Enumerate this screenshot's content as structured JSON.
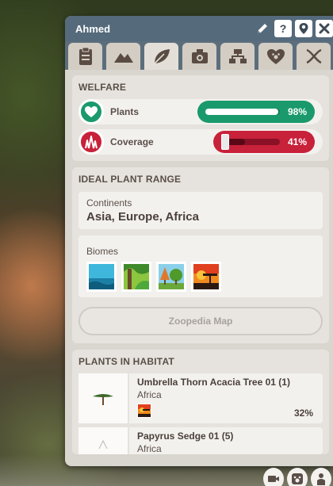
{
  "window": {
    "title": "Ahmed"
  },
  "titlebar_icons": [
    "pencil-icon",
    "help-icon",
    "location-pin-icon",
    "close-icon"
  ],
  "titlebar_glyphs": {
    "help": "?"
  },
  "tabs": [
    {
      "icon": "clipboard-icon",
      "active": false
    },
    {
      "icon": "terrain-icon",
      "active": false
    },
    {
      "icon": "plant-leaf-icon",
      "active": true
    },
    {
      "icon": "enrichment-icon",
      "active": false
    },
    {
      "icon": "hierarchy-icon",
      "active": false
    },
    {
      "icon": "paw-heart-icon",
      "active": false
    },
    {
      "icon": "dna-icon",
      "active": false
    }
  ],
  "welfare": {
    "title": "WELFARE",
    "items": [
      {
        "label": "Plants",
        "percent_text": "98%",
        "value": 0.98,
        "color": "#1a9a6c",
        "icon": "heart-icon"
      },
      {
        "label": "Coverage",
        "percent_text": "41%",
        "value": 0.41,
        "color": "#c8213a",
        "icon": "grass-icon"
      }
    ]
  },
  "ideal_range": {
    "title": "IDEAL PLANT RANGE",
    "continents_label": "Continents",
    "continents_value": "Asia, Europe, Africa",
    "biomes_label": "Biomes",
    "biomes": [
      "aquatic-biome-icon",
      "tropical-biome-icon",
      "temperate-biome-icon",
      "savanna-biome-icon"
    ],
    "map_button": "Zoopedia Map"
  },
  "plants": {
    "title": "PLANTS IN HABITAT",
    "items": [
      {
        "name": "Umbrella Thorn Acacia Tree 01 (1)",
        "region": "Africa",
        "percent": "32%",
        "biome": "savanna-biome-icon"
      },
      {
        "name": "Papyrus Sedge 01 (5)",
        "region": "Africa",
        "percent": "",
        "biome": ""
      }
    ]
  },
  "bottom_toolbar": [
    "camera-icon",
    "paw-badge-icon",
    "person-icon"
  ]
}
